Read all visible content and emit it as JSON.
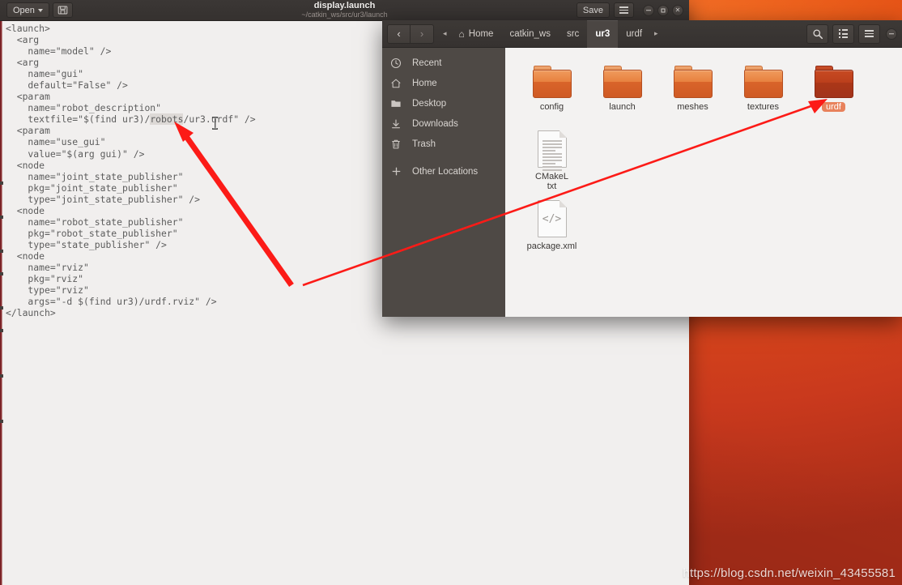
{
  "desktop": {
    "wallpaper_color": "#d6411e",
    "watermark": "https://blog.csdn.net/weixin_43455581"
  },
  "editor_window": {
    "title": "display.launch",
    "subtitle": "~/catkin_ws/src/ur3/launch",
    "open_button": "Open",
    "save_button": "Save",
    "icons": {
      "save_as": "save-as-icon",
      "menu": "hamburger-menu-icon",
      "minimize": "minimize-icon",
      "maximize": "maximize-icon",
      "close": "close-icon",
      "caret": "chevron-down-icon"
    },
    "code": {
      "pre_highlight": "<launch>\n  <arg\n    name=\"model\" />\n  <arg\n    name=\"gui\"\n    default=\"False\" />\n  <param\n    name=\"robot_description\"\n    textfile=\"$(find ur3)/",
      "highlight": "robots",
      "post_highlight": "/ur3.urdf\" />\n  <param\n    name=\"use_gui\"\n    value=\"$(arg gui)\" />\n  <node\n    name=\"joint_state_publisher\"\n    pkg=\"joint_state_publisher\"\n    type=\"joint_state_publisher\" />\n  <node\n    name=\"robot_state_publisher\"\n    pkg=\"robot_state_publisher\"\n    type=\"state_publisher\" />\n  <node\n    name=\"rviz\"\n    pkg=\"rviz\"\n    type=\"rviz\"\n    args=\"-d $(find ur3)/urdf.rviz\" />\n</launch>",
      "selection_color": "#ddd9d6",
      "text_color": "#5c5c5c"
    },
    "cursor": "text-ibeam-cursor"
  },
  "file_manager": {
    "nav": {
      "back": "‹",
      "forward": "›",
      "prev_crumb": "◂",
      "next_crumb": "▸"
    },
    "breadcrumb": [
      {
        "label": "Home",
        "icon": "home-icon",
        "active": false
      },
      {
        "label": "catkin_ws",
        "icon": "",
        "active": false
      },
      {
        "label": "src",
        "icon": "",
        "active": false
      },
      {
        "label": "ur3",
        "icon": "",
        "active": true
      },
      {
        "label": "urdf",
        "icon": "",
        "active": false
      }
    ],
    "toolbar": {
      "search": "search-icon",
      "list_view": "list-view-icon",
      "menu": "hamburger-menu-icon",
      "minimize": "minimize-icon"
    },
    "sidebar": [
      {
        "label": "Recent",
        "icon": "clock-icon"
      },
      {
        "label": "Home",
        "icon": "home-icon"
      },
      {
        "label": "Desktop",
        "icon": "folder-icon"
      },
      {
        "label": "Downloads",
        "icon": "download-icon"
      },
      {
        "label": "Trash",
        "icon": "trash-icon"
      },
      {
        "label": "Other Locations",
        "icon": "plus-icon"
      }
    ],
    "files": [
      {
        "name": "config",
        "type": "folder",
        "selected": false
      },
      {
        "name": "launch",
        "type": "folder",
        "selected": false
      },
      {
        "name": "meshes",
        "type": "folder",
        "selected": false
      },
      {
        "name": "textures",
        "type": "folder",
        "selected": false
      },
      {
        "name": "urdf",
        "type": "folder",
        "selected": true
      },
      {
        "name": "CMakeL\ntxt",
        "type": "document",
        "selected": false
      },
      {
        "name": "package.xml",
        "type": "code-document",
        "selected": false
      }
    ],
    "selection_color": "#e8825c"
  },
  "annotations": {
    "arrow_color": "#fc1b17",
    "arrow_1_desc": "thick-arrow-pointing-to-robots-path",
    "arrow_2_desc": "thin-line-from-urdf-folder"
  }
}
